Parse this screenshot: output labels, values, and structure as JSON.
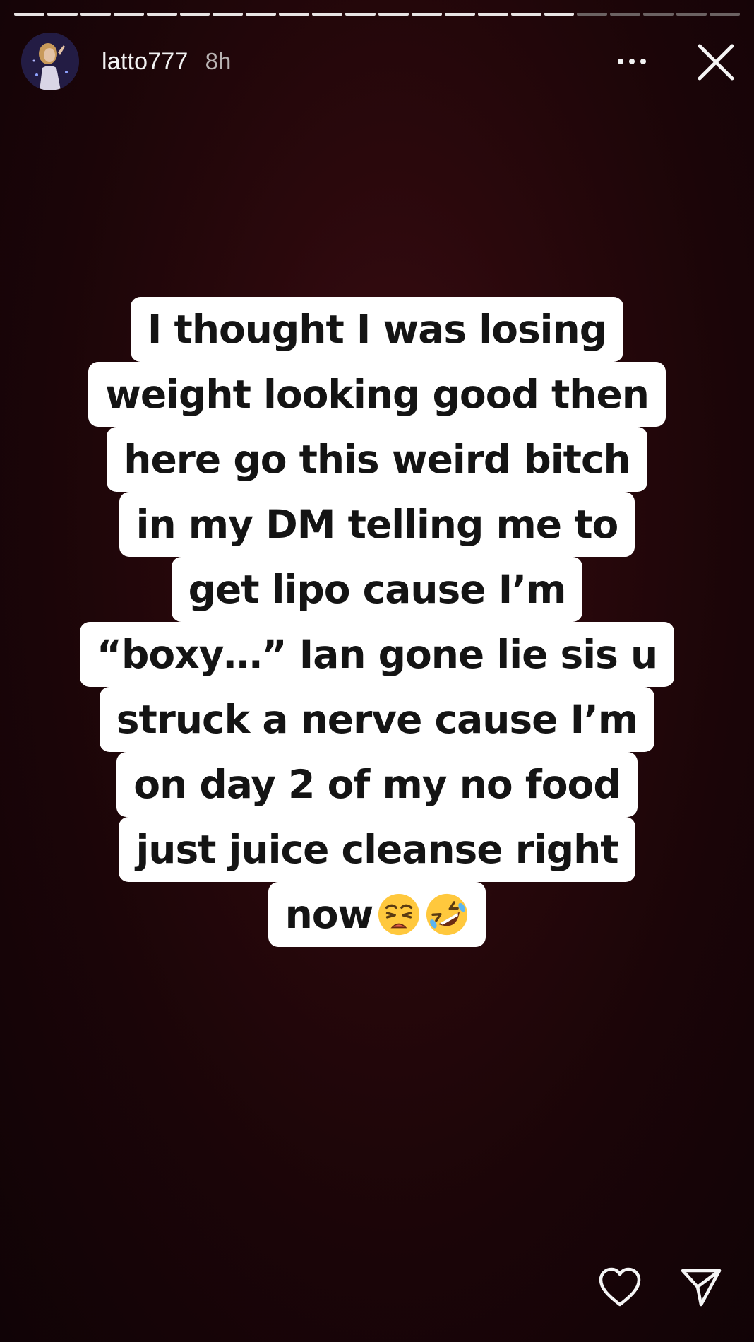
{
  "story": {
    "progress_total": 22,
    "progress_done": 17
  },
  "header": {
    "username": "latto777",
    "timestamp": "8h",
    "more_icon": "more-horizontal-icon",
    "close_icon": "close-icon"
  },
  "caption": {
    "lines": [
      "I thought I was losing",
      "weight looking good then",
      "here go this weird bitch",
      "in my DM telling me to",
      "get lipo cause I’m",
      "“boxy…” Ian gone lie sis u",
      "struck a nerve cause I’m",
      "on day 2 of my no food",
      "just juice cleanse right",
      "now"
    ],
    "emojis": [
      "weary-face-emoji",
      "rolling-on-floor-laughing-emoji"
    ]
  },
  "footer": {
    "like_icon": "heart-icon",
    "share_icon": "send-icon"
  }
}
